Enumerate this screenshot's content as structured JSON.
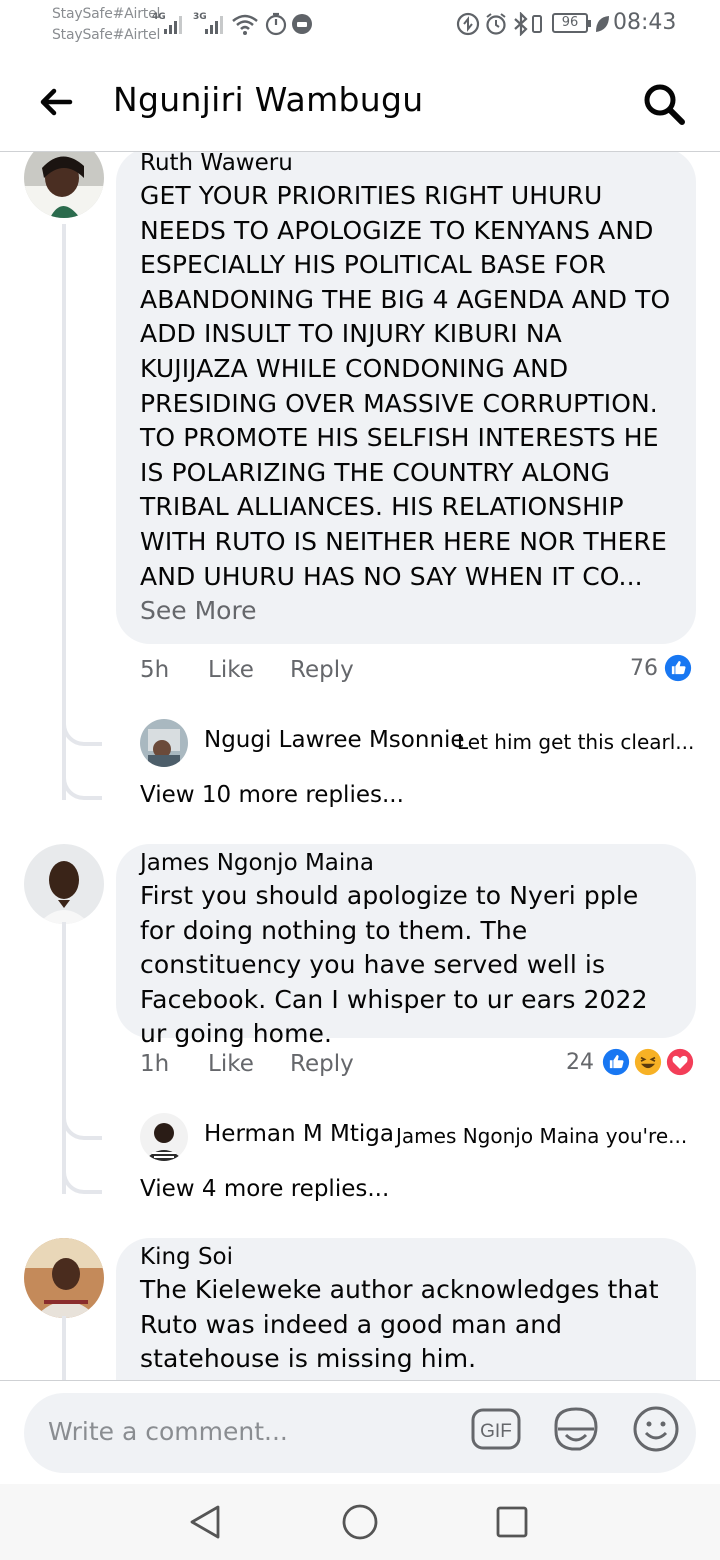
{
  "status_bar": {
    "carrier_1": "StaySafe#Airtel",
    "carrier_2": "StaySafe#Airtel",
    "net_1": "4G",
    "net_2": "3G",
    "battery": "96",
    "time": "08:43"
  },
  "header": {
    "title": "Ngunjiri Wambugu"
  },
  "comments": [
    {
      "author": "Ruth Waweru",
      "text": "GET YOUR PRIORITIES RIGHT UHURU NEEDS TO APOLOGIZE TO KENYANS AND ESPECIALLY HIS POLITICAL BASE FOR ABANDONING THE BIG 4 AGENDA AND TO ADD INSULT TO INJURY KIBURI NA KUJIJAZA WHILE CONDONING AND PRESIDING OVER MASSIVE CORRUPTION. TO PROMOTE HIS SELFISH INTERESTS HE IS POLARIZING THE COUNTRY ALONG TRIBAL ALLIANCES. HIS RELATIONSHIP WITH RUTO IS NEITHER HERE NOR THERE AND UHURU HAS NO SAY WHEN IT CO...",
      "see_more": "See More",
      "time": "5h",
      "like": "Like",
      "reply": "Reply",
      "reaction_count": "76",
      "reactions": [
        "like"
      ],
      "reply_preview": {
        "author": "Ngugi Lawree Msonnie",
        "text": "Let him get this clearl..."
      },
      "view_more": "View 10 more replies..."
    },
    {
      "author": "James Ngonjo Maina",
      "text": "First you should apologize to Nyeri pple for doing nothing to them. The constituency you have served well is Facebook. Can I whisper to ur ears 2022 ur going home.",
      "time": "1h",
      "like": "Like",
      "reply": "Reply",
      "reaction_count": "24",
      "reactions": [
        "like",
        "haha",
        "love"
      ],
      "reply_preview": {
        "author": "Herman M Mtiga",
        "text": "James Ngonjo Maina you're..."
      },
      "view_more": "View 4 more replies..."
    },
    {
      "author": "King Soi",
      "text": "The Kieleweke author acknowledges that Ruto was indeed a good man and statehouse is missing him."
    }
  ],
  "composer": {
    "placeholder": "Write a comment...",
    "gif_label": "GIF"
  },
  "colors": {
    "bubble": "#f0f2f5",
    "like_blue": "#1877f2",
    "love_red": "#f33e58",
    "haha_yellow": "#f7b125",
    "secondary_text": "#65676b"
  },
  "icons": {
    "back": "arrow-left-icon",
    "search": "search-icon",
    "gif": "gif-icon",
    "sticker": "sticker-icon",
    "emoji": "emoji-icon"
  }
}
